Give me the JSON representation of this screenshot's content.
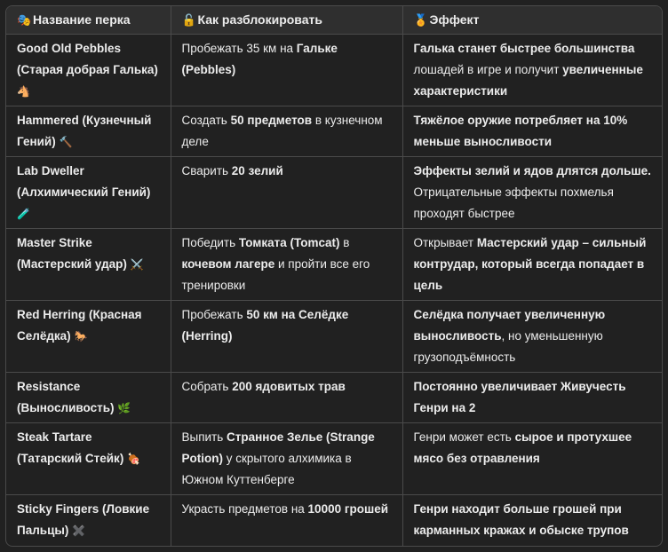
{
  "headers": [
    {
      "icon": "🎭",
      "label": "Название перка"
    },
    {
      "icon": "🔓",
      "label": "Как разблокировать"
    },
    {
      "icon": "🏅",
      "label": "Эффект"
    }
  ],
  "rows": [
    {
      "name": "Good Old Pebbles (Старая добрая Галька)",
      "emoji": "🐴",
      "unlock": [
        {
          "t": "Пробежать 35 км на "
        },
        {
          "t": "Гальке (Pebbles)",
          "b": true
        }
      ],
      "effect": [
        {
          "t": "Галька станет быстрее большинства",
          "b": true
        },
        {
          "t": " лошадей в игре и получит "
        },
        {
          "t": "увеличенные характеристики",
          "b": true
        }
      ]
    },
    {
      "name": "Hammered (Кузнечный Гений)",
      "emoji": "🔨",
      "unlock": [
        {
          "t": "Создать "
        },
        {
          "t": "50 предметов",
          "b": true
        },
        {
          "t": " в кузнечном деле"
        }
      ],
      "effect": [
        {
          "t": "Тяжёлое оружие потребляет на 10% меньше выносливости",
          "b": true
        }
      ]
    },
    {
      "name": "Lab Dweller (Алхимический Гений)",
      "emoji": "🧪",
      "unlock": [
        {
          "t": "Сварить "
        },
        {
          "t": "20 зелий",
          "b": true
        }
      ],
      "effect": [
        {
          "t": "Эффекты зелий и ядов длятся дольше.",
          "b": true
        },
        {
          "t": " Отрицательные эффекты похмелья проходят быстрее"
        }
      ]
    },
    {
      "name": "Master Strike (Мастерский удар)",
      "emoji": "⚔️",
      "unlock": [
        {
          "t": "Победить "
        },
        {
          "t": "Томката (Tomcat)",
          "b": true
        },
        {
          "t": " в "
        },
        {
          "t": "кочевом лагере",
          "b": true
        },
        {
          "t": " и пройти все его тренировки"
        }
      ],
      "effect": [
        {
          "t": "Открывает "
        },
        {
          "t": "Мастерский удар – сильный контрудар, который всегда попадает в цель",
          "b": true
        }
      ]
    },
    {
      "name": "Red Herring (Красная Селёдка)",
      "emoji": "🐎",
      "unlock": [
        {
          "t": "Пробежать "
        },
        {
          "t": "50 км на Селёдке (Herring)",
          "b": true
        }
      ],
      "effect": [
        {
          "t": "Селёдка получает увеличенную выносливость",
          "b": true
        },
        {
          "t": ", но уменьшенную грузоподъёмность"
        }
      ]
    },
    {
      "name": "Resistance (Выносливость)",
      "emoji": "🌿",
      "unlock": [
        {
          "t": "Собрать "
        },
        {
          "t": "200 ядовитых трав",
          "b": true
        }
      ],
      "effect": [
        {
          "t": "Постоянно увеличивает Живучесть Генри на 2",
          "b": true
        }
      ]
    },
    {
      "name": "Steak Tartare (Татарский Стейк)",
      "emoji": "🍖",
      "unlock": [
        {
          "t": "Выпить "
        },
        {
          "t": "Странное Зелье (Strange Potion)",
          "b": true
        },
        {
          "t": " у скрытого алхимика в Южном Куттенберге"
        }
      ],
      "effect": [
        {
          "t": "Генри может есть "
        },
        {
          "t": "сырое и протухшее мясо без отравления",
          "b": true
        }
      ]
    },
    {
      "name": "Sticky Fingers (Ловкие Пальцы)",
      "emoji": "✖️",
      "unlock": [
        {
          "t": "Украсть предметов на "
        },
        {
          "t": "10000 грошей",
          "b": true
        }
      ],
      "effect": [
        {
          "t": "Генри находит больше грошей при карманных кражах и обыске трупов",
          "b": true
        }
      ]
    }
  ]
}
